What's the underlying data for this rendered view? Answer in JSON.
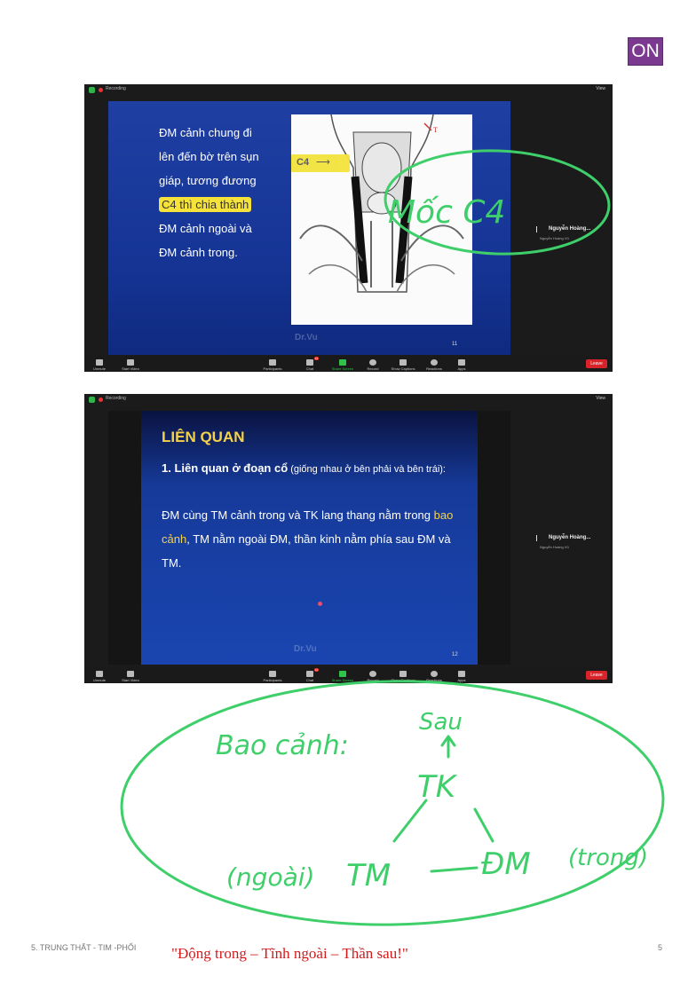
{
  "badge": "ON",
  "meeting1": {
    "recording_label": "Recording",
    "view_label": "View",
    "slide": {
      "line1": "ĐM cảnh chung đi",
      "line2": "lên đến bờ  trên sụn",
      "line3": "giáp, tương đương",
      "highlight": "C4 thì chia thành",
      "line5": "ĐM cảnh ngoài và",
      "line6": "ĐM cảnh trong.",
      "image_label": "C4",
      "watermark": "Dr.Vu",
      "number": "11"
    },
    "participant": {
      "name": "Nguyễn Hoàng...",
      "sub": "Nguyễn Hoàng Vũ"
    },
    "toolbar": {
      "unmute": "Unmute",
      "start_video": "Start Video",
      "participants": "Participants",
      "participants_count": "346",
      "chat": "Chat",
      "chat_badge": "14",
      "share": "Share Screen",
      "record": "Record",
      "captions": "Show Captions",
      "reactions": "Reactions",
      "apps": "Apps",
      "leave": "Leave"
    }
  },
  "meeting2": {
    "recording_label": "Recording",
    "view_label": "View",
    "slide": {
      "title": "LIÊN QUAN",
      "p1_bold": "1. Liên quan ở đoạn cổ",
      "p1_rest": " (giống nhau ở bên phải và bên trái):",
      "p2_start": "ĐM cùng TM cảnh trong và TK lang thang nằm trong ",
      "p2_highlight": "bao cảnh",
      "p2_end": ", TM nằm ngoài ĐM, thần kinh nằm phía sau ĐM và TM.",
      "watermark": "Dr.Vu",
      "number": "12"
    },
    "participant": {
      "name": "Nguyễn Hoàng...",
      "sub": "Nguyễn Hoàng Vũ"
    },
    "toolbar": {
      "unmute": "Unmute",
      "start_video": "Start Video",
      "participants": "Participants",
      "participants_count": "347",
      "chat": "Chat",
      "chat_badge": "14",
      "share": "Share Screen",
      "record": "Record",
      "captions": "Show Captions",
      "reactions": "Reactions",
      "apps": "Apps",
      "leave": "Leave"
    }
  },
  "handwriting": {
    "note1": "Mốc C4",
    "bao": "Bao cảnh:",
    "sau": "Sau",
    "tk": "TK",
    "ngoai": "(ngoài)",
    "tm": "TM",
    "dm": "ĐM",
    "trong": "(trong)"
  },
  "footer": {
    "left": "5. TRUNG THẤT - TIM -PHỔI",
    "quote": "\"Động trong – Tĩnh ngoài – Thần sau!\"",
    "page": "5"
  }
}
